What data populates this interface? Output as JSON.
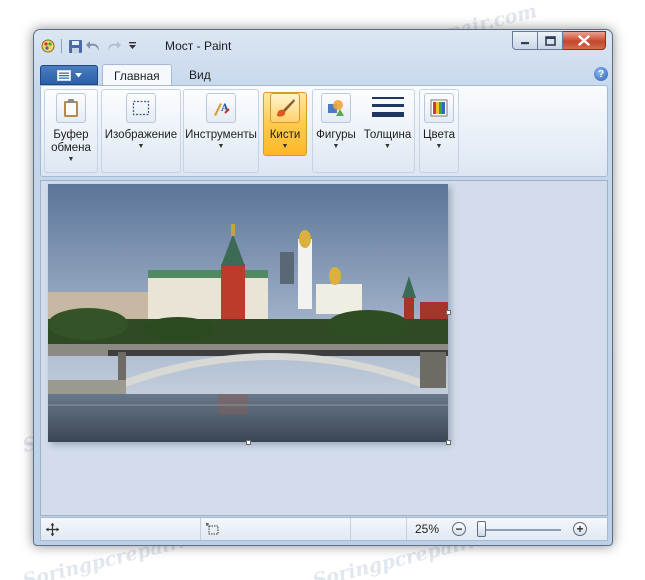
{
  "window": {
    "title": "Мост - Paint"
  },
  "quick_access": [
    "paint-app-icon",
    "save-icon",
    "undo-icon",
    "redo-icon",
    "customize-qat-icon"
  ],
  "ribbon": {
    "tabs": [
      {
        "label": "Главная",
        "active": true
      },
      {
        "label": "Вид",
        "active": false
      }
    ],
    "buttons": [
      {
        "label": "Буфер\nобмена",
        "icon": "clipboard-icon"
      },
      {
        "label": "Изображение",
        "icon": "image-select-icon"
      },
      {
        "label": "Инструменты",
        "icon": "tools-icon"
      },
      {
        "label": "Кисти",
        "icon": "brush-icon",
        "highlighted": true
      },
      {
        "label": "Фигуры",
        "icon": "shapes-icon"
      },
      {
        "label": "Толщина",
        "icon": "line-size-icon"
      },
      {
        "label": "Цвета",
        "icon": "colors-icon"
      }
    ]
  },
  "status": {
    "zoom": "25%",
    "zoom_level": 0.25
  },
  "watermark": "Soringpcrepair.com",
  "colors": {
    "window_bg": "#c7d8ec",
    "workspace": "#d2dcea",
    "highlight": "#ffca4c",
    "close_btn": "#c7462b"
  }
}
